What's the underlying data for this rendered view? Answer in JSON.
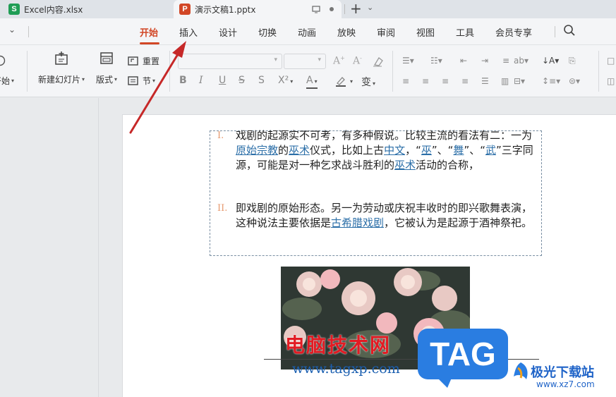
{
  "tabs": [
    {
      "icon_letter": "S",
      "label": "Excel内容.xlsx",
      "color": "#1f9d55"
    },
    {
      "icon_letter": "P",
      "label": "演示文稿1.pptx",
      "color": "#d24726"
    }
  ],
  "tabbar": {
    "new_tab": "+",
    "menu_caret": "⌄"
  },
  "menu": {
    "items": [
      "开始",
      "插入",
      "设计",
      "切换",
      "动画",
      "放映",
      "审阅",
      "视图",
      "工具",
      "会员专享"
    ],
    "active": "开始",
    "accent": "#d24726"
  },
  "ribbon": {
    "start_partial": "开始",
    "new_slide": "新建幻灯片",
    "layout": "版式",
    "reset": "重置",
    "section": "节",
    "font_buttons": [
      "B",
      "I",
      "U",
      "S",
      "S",
      "X²",
      "A",
      "A",
      "变"
    ]
  },
  "slide": {
    "paragraphs": [
      {
        "num": "I.",
        "segments": [
          {
            "t": "戏剧的起源实不可考，有多种假说。比较主流的看法有二：一为"
          },
          {
            "t": "原始宗教",
            "link": true
          },
          {
            "t": "的"
          },
          {
            "t": "巫术",
            "link": true
          },
          {
            "t": "仪式，比如上古"
          },
          {
            "t": "中文",
            "link": true
          },
          {
            "t": "，“"
          },
          {
            "t": "巫",
            "link": true
          },
          {
            "t": "”、“"
          },
          {
            "t": "舞",
            "link": true
          },
          {
            "t": "”、“"
          },
          {
            "t": "武",
            "link": true
          },
          {
            "t": "”三字同源，可能是对一种乞求战斗胜利的"
          },
          {
            "t": "巫术",
            "link": true
          },
          {
            "t": "活动的合称，"
          }
        ]
      },
      {
        "num": "II.",
        "segments": [
          {
            "t": "即戏剧的原始形态。另一为劳动或庆祝丰收时的即兴歌舞表演，这种说法主要依据是"
          },
          {
            "t": "古希腊戏剧",
            "link": true
          },
          {
            "t": "，它被认为是起源于酒神祭祀。"
          }
        ]
      }
    ],
    "link_color": "#2c6fa8"
  },
  "watermarks": {
    "red_text": "电脑技术网",
    "url": "www.tagxp.com",
    "tag": "TAG",
    "site_name": "极光下载站",
    "site_url": "www.xz7.com"
  },
  "annotation": {
    "color": "#c62828",
    "points_to": "插入"
  }
}
